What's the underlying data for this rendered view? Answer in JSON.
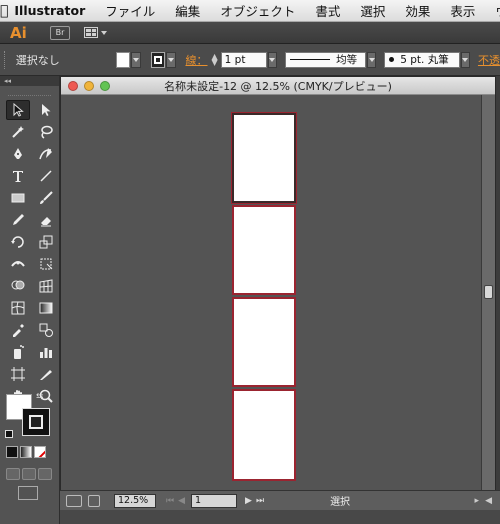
{
  "menubar": {
    "app_name": "Illustrator",
    "items": [
      "ファイル",
      "編集",
      "オブジェクト",
      "書式",
      "選択",
      "効果",
      "表示",
      "ウィン"
    ]
  },
  "appbar": {
    "logo": "Ai",
    "bridge_label": "Br"
  },
  "controlbar": {
    "selection_status": "選択なし",
    "stroke_label": "線：",
    "stroke_weight": "1 pt",
    "stroke_profile": "均等",
    "brush": "5 pt. 丸筆",
    "opacity_label": "不透"
  },
  "document": {
    "title": "名称未設定-12 @ 12.5% (CMYK/プレビュー)",
    "artboard_count": 4
  },
  "statusbar": {
    "zoom": "12.5%",
    "artboard_number": "1",
    "status_text": "選択"
  },
  "colors": {
    "artboard_border": "#9b2430",
    "accent_orange": "#e8902e",
    "canvas_bg": "#545454"
  }
}
